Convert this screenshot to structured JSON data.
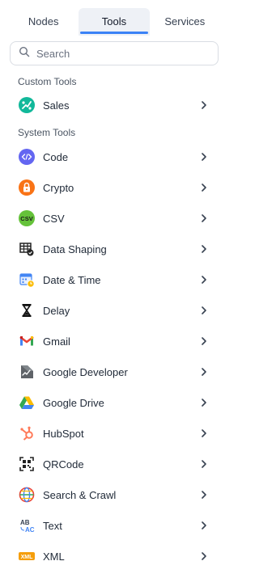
{
  "tabs": [
    {
      "label": "Nodes",
      "active": false
    },
    {
      "label": "Tools",
      "active": true
    },
    {
      "label": "Services",
      "active": false
    }
  ],
  "search": {
    "placeholder": "Search",
    "value": ""
  },
  "sections": {
    "custom": "Custom Tools",
    "system": "System Tools"
  },
  "custom_tools": [
    {
      "label": "Sales",
      "icon": "sales-icon"
    }
  ],
  "system_tools": [
    {
      "label": "Code",
      "icon": "code-icon"
    },
    {
      "label": "Crypto",
      "icon": "lock-icon"
    },
    {
      "label": "CSV",
      "icon": "csv-icon"
    },
    {
      "label": "Data Shaping",
      "icon": "table-check-icon"
    },
    {
      "label": "Date & Time",
      "icon": "calendar-clock-icon"
    },
    {
      "label": "Delay",
      "icon": "hourglass-icon"
    },
    {
      "label": "Gmail",
      "icon": "gmail-icon"
    },
    {
      "label": "Google Developer",
      "icon": "google-developer-icon"
    },
    {
      "label": "Google Drive",
      "icon": "google-drive-icon"
    },
    {
      "label": "HubSpot",
      "icon": "hubspot-icon"
    },
    {
      "label": "QRCode",
      "icon": "qrcode-icon"
    },
    {
      "label": "Search & Crawl",
      "icon": "globe-icon"
    },
    {
      "label": "Text",
      "icon": "text-ab-icon"
    },
    {
      "label": "XML",
      "icon": "xml-icon"
    }
  ],
  "colors": {
    "accent": "#3b82f6",
    "tab_active_bg": "#eef1f6"
  }
}
